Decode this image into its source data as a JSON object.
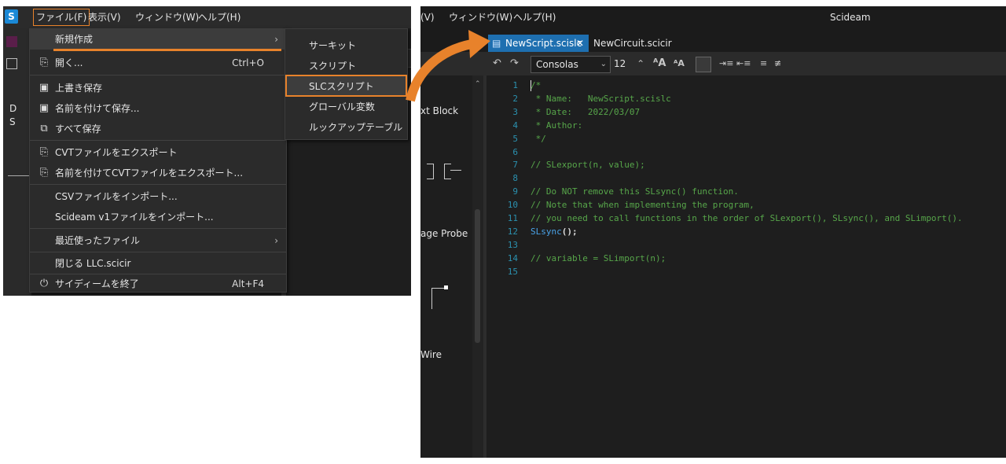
{
  "left": {
    "menubar": {
      "file": "ファイル(F)",
      "view": "表示(V)",
      "window": "ウィンドウ(W)",
      "help": "ヘルプ(H)"
    },
    "background": {
      "d": "D",
      "s": "S"
    },
    "file_menu": {
      "new": "新規作成",
      "open": "開く...",
      "open_shortcut": "Ctrl+O",
      "overwrite_save": "上書き保存",
      "save_as": "名前を付けて保存...",
      "save_all": "すべて保存",
      "export_cvt": "CVTファイルをエクスポート",
      "export_cvt_as": "名前を付けてCVTファイルをエクスポート...",
      "import_csv": "CSVファイルをインポート...",
      "import_v1": "Scideam v1ファイルをインポート...",
      "recent": "最近使ったファイル",
      "close": "閉じる LLC.scicir",
      "exit": "サイディームを終了",
      "exit_shortcut": "Alt+F4"
    },
    "submenu": {
      "circuit": "サーキット",
      "script": "スクリプト",
      "slc_script": "SLCスクリプト",
      "global_var": "グローバル変数",
      "lookup_table": "ルックアップテーブル"
    }
  },
  "right": {
    "menubar": {
      "view_partial": "(V)",
      "window": "ウィンドウ(W)",
      "help": "ヘルプ(H)",
      "app_title": "Scideam"
    },
    "tabs": {
      "active": "NewScript.scislc",
      "active_close": "✕",
      "inactive": "NewCircuit.scicir"
    },
    "toolbar": {
      "font": "Consolas",
      "size": "12"
    },
    "left_pane": {
      "text_block": "xt Block",
      "probe": "age Probe",
      "wire": "Wire"
    },
    "editor": {
      "lines": [
        {
          "n": "1",
          "text": "/*"
        },
        {
          "n": "2",
          "text": " * Name:   NewScript.scislc"
        },
        {
          "n": "3",
          "text": " * Date:   2022/03/07"
        },
        {
          "n": "4",
          "text": " * Author:"
        },
        {
          "n": "5",
          "text": " */"
        },
        {
          "n": "6",
          "text": ""
        },
        {
          "n": "7",
          "text": "// SLexport(n, value);"
        },
        {
          "n": "8",
          "text": ""
        },
        {
          "n": "9",
          "text": "// Do NOT remove this SLsync() function."
        },
        {
          "n": "10",
          "text": "// Note that when implementing the program,"
        },
        {
          "n": "11",
          "text": "// you need to call functions in the order of SLexport(), SLsync(), and SLimport()."
        },
        {
          "n": "12",
          "text": "SLsync();"
        },
        {
          "n": "13",
          "text": ""
        },
        {
          "n": "14",
          "text": "// variable = SLimport(n);"
        },
        {
          "n": "15",
          "text": ""
        }
      ]
    }
  },
  "colors": {
    "accent_orange": "#e8822b",
    "tab_blue": "#1e6fb0",
    "comment_green": "#57a64a",
    "keyword_blue": "#4aa3e8"
  }
}
